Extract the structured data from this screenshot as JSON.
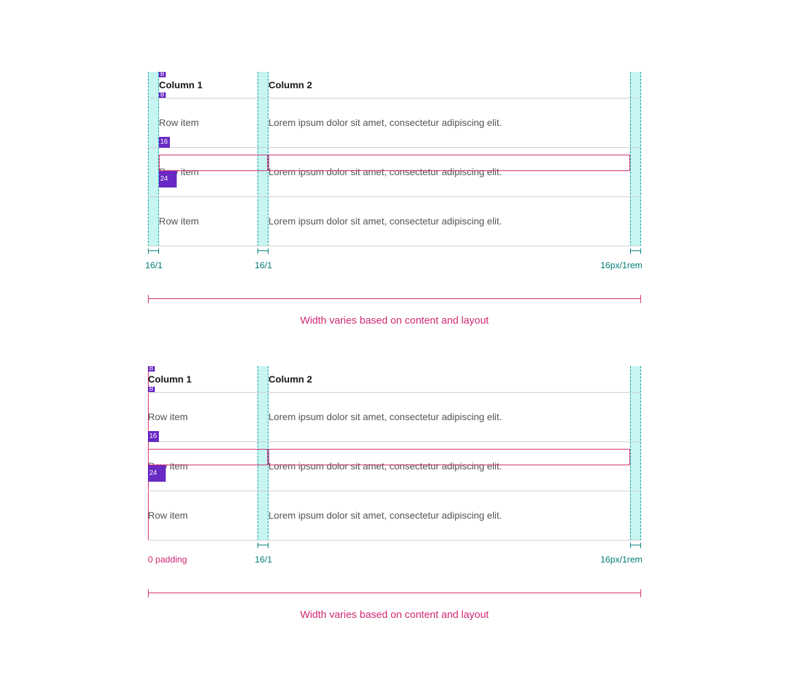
{
  "columns": {
    "col1": "Column 1",
    "col2": "Column 2"
  },
  "rows": [
    {
      "item": "Row item",
      "text": "Lorem ipsum dolor sit amet, consectetur adipiscing elit."
    },
    {
      "item": "Row item",
      "text": "Lorem ipsum dolor sit amet, consectetur adipiscing elit."
    },
    {
      "item": "Row item",
      "text": "Lorem ipsum dolor sit amet, consectetur adipiscing elit."
    }
  ],
  "spacing_markers": {
    "top": "8",
    "below_header": "8",
    "row2_top": "16",
    "row2_bottom": "24"
  },
  "dimensions": {
    "left": "16/1",
    "mid": "16/1",
    "right": "16px/1rem",
    "zero_padding": "0 padding"
  },
  "width_note": "Width varies based on content and layout",
  "colors": {
    "teal": "#007d79",
    "teal_band": "#c6f5f2",
    "magenta": "#d12771",
    "purple": "#6929c4"
  }
}
